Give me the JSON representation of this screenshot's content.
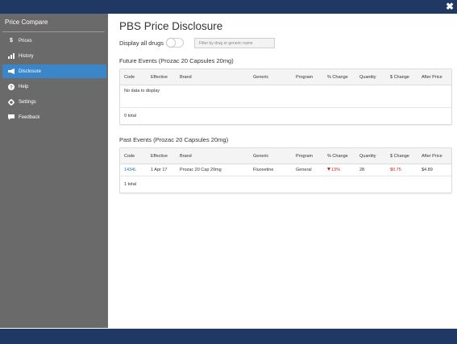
{
  "window": {
    "close_symbol": "✖"
  },
  "sidebar": {
    "title": "Price Compare",
    "items": [
      {
        "label": "Prices",
        "icon": "dollar-icon",
        "glyph": "$"
      },
      {
        "label": "History",
        "icon": "bar-chart-icon",
        "glyph": "▮"
      },
      {
        "label": "Disclosure",
        "icon": "megaphone-icon",
        "glyph": "◀"
      },
      {
        "label": "Help",
        "icon": "question-circle-icon",
        "glyph": "?"
      },
      {
        "label": "Settings",
        "icon": "gear-icon",
        "glyph": "✱"
      },
      {
        "label": "Feedback",
        "icon": "comment-icon",
        "glyph": "▬"
      }
    ],
    "active_index": 2
  },
  "main": {
    "title": "PBS Price Disclosure",
    "display_all_label": "Display all drugs",
    "display_all_on": false,
    "filter_placeholder": "Filter by drug or generic name",
    "columns": [
      "Code",
      "Effective",
      "Brand",
      "Generic",
      "Program",
      "% Change",
      "Quantity",
      "$ Change",
      "After Price"
    ],
    "future": {
      "title": "Future Events (Prozac 20 Capsules 20mg)",
      "empty_text": "No data to display",
      "total": "0 total"
    },
    "past": {
      "title": "Past Events (Prozac 20 Capsules 20mg)",
      "rows": [
        {
          "code": "1434L",
          "effective": "1 Apr 17",
          "brand": "Prozac 20 Cap 20mg",
          "generic": "Fluoxetine",
          "program": "General",
          "pct_change": "13%",
          "quantity": "28",
          "dollar_change": "$0.75",
          "after_price": "$4.89"
        }
      ],
      "total": "1 total"
    }
  },
  "colors": {
    "topbar": "#1f3864",
    "sidebar": "#6a6a6a",
    "active": "#3a86c8",
    "negative": "#d9221c",
    "link": "#2a6fbd"
  }
}
